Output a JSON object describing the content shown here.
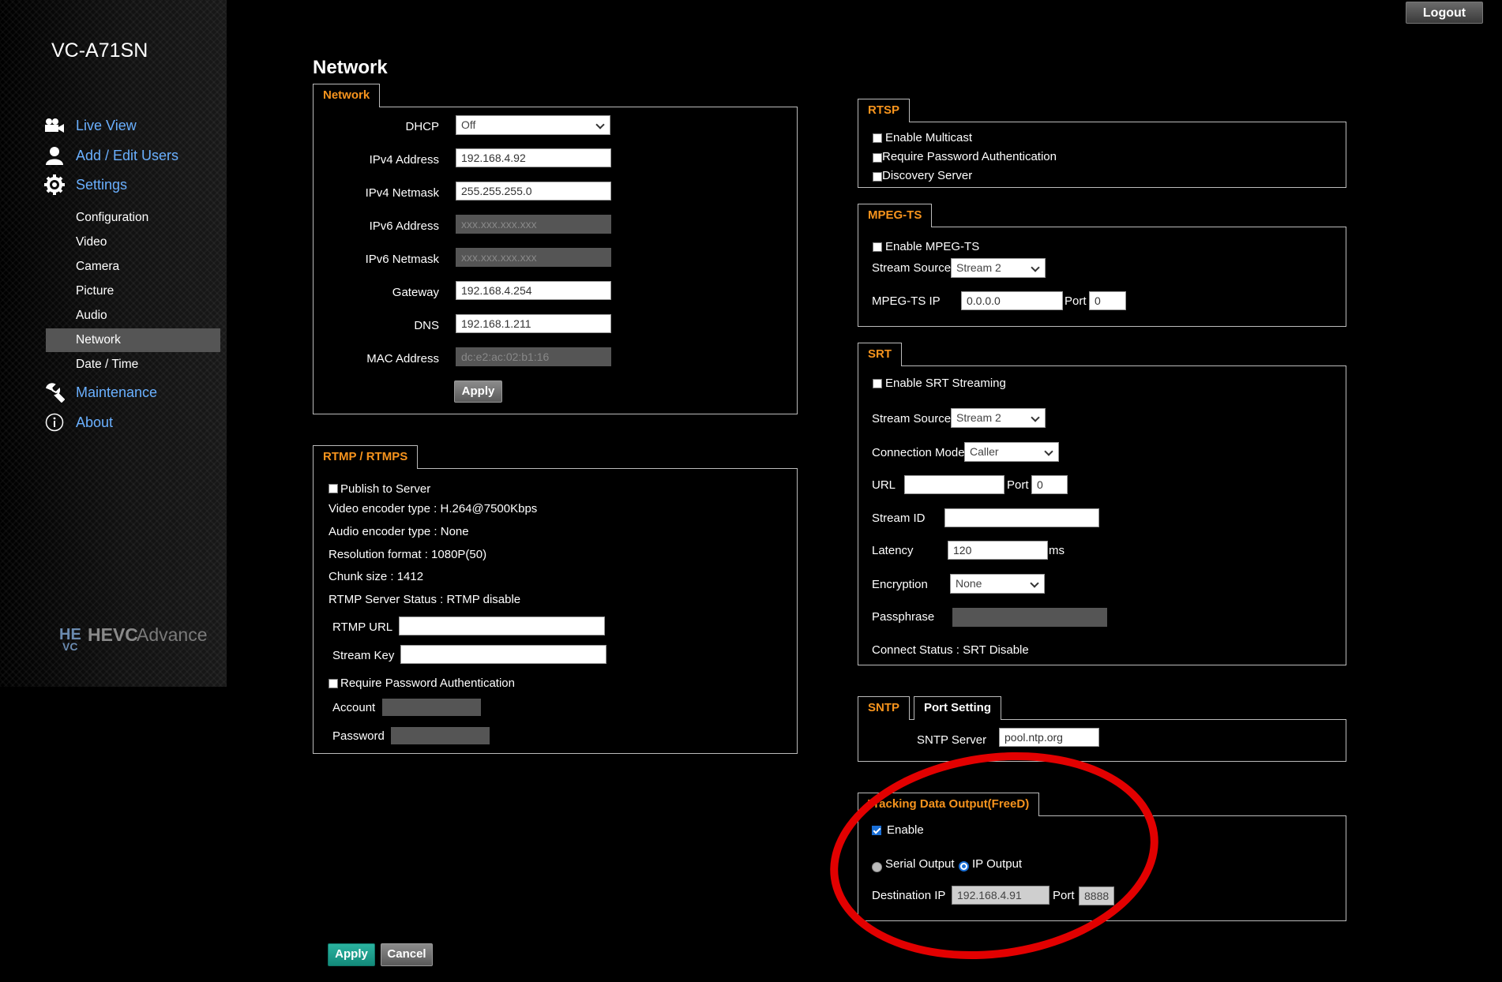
{
  "header": {
    "logout_label": "Logout",
    "device_name": "VC-A71SN"
  },
  "sidebar": {
    "main_items": [
      {
        "label": "Live View",
        "icon": "camera-icon"
      },
      {
        "label": "Add / Edit Users",
        "icon": "user-icon"
      },
      {
        "label": "Settings",
        "icon": "gear-icon"
      },
      {
        "label": "Maintenance",
        "icon": "wrench-icon"
      },
      {
        "label": "About",
        "icon": "info-icon"
      }
    ],
    "sub_items": [
      "Configuration",
      "Video",
      "Camera",
      "Picture",
      "Audio",
      "Network",
      "Date / Time"
    ],
    "active_sub_item": "Network",
    "logo_text": "HEVCAdvance"
  },
  "page": {
    "title": "Network"
  },
  "network": {
    "tab_label": "Network",
    "dhcp_label": "DHCP",
    "dhcp_value": "Off",
    "ipv4_address_label": "IPv4 Address",
    "ipv4_address": "192.168.4.92",
    "ipv4_netmask_label": "IPv4 Netmask",
    "ipv4_netmask": "255.255.255.0",
    "ipv6_address_label": "IPv6 Address",
    "ipv6_address": "xxx.xxx.xxx.xxx",
    "ipv6_netmask_label": "IPv6 Netmask",
    "ipv6_netmask": "xxx.xxx.xxx.xxx",
    "gateway_label": "Gateway",
    "gateway": "192.168.4.254",
    "dns_label": "DNS",
    "dns": "192.168.1.211",
    "mac_label": "MAC Address",
    "mac": "dc:e2:ac:02:b1:16",
    "apply_label": "Apply"
  },
  "rtmp": {
    "tab_label": "RTMP / RTMPS",
    "publish_label": "Publish to Server",
    "video_encoder": "Video encoder type : H.264@7500Kbps",
    "audio_encoder": "Audio encoder type : None",
    "resolution": "Resolution format : 1080P(50)",
    "chunk_size": "Chunk size : 1412",
    "server_status": "RTMP Server Status : RTMP disable",
    "url_label": "RTMP URL",
    "url_value": "",
    "stream_key_label": "Stream Key",
    "stream_key_value": "",
    "require_password_label": "Require Password Authentication",
    "account_label": "Account",
    "password_label": "Password"
  },
  "rtsp": {
    "tab_label": "RTSP",
    "enable_multicast_label": "Enable Multicast",
    "require_password_label": "Require Password Authentication",
    "discovery_server_label": "Discovery Server"
  },
  "mpegts": {
    "tab_label": "MPEG-TS",
    "enable_label": "Enable MPEG-TS",
    "stream_source_label": "Stream Source",
    "stream_source_value": "Stream 2",
    "ip_label": "MPEG-TS IP",
    "ip_value": "0.0.0.0",
    "port_label": "Port",
    "port_value": "0"
  },
  "srt": {
    "tab_label": "SRT",
    "enable_label": "Enable SRT Streaming",
    "stream_source_label": "Stream Source",
    "stream_source_value": "Stream 2",
    "connection_mode_label": "Connection Mode",
    "connection_mode_value": "Caller",
    "url_label": "URL",
    "url_value": "",
    "port_label": "Port",
    "port_value": "0",
    "stream_id_label": "Stream ID",
    "stream_id_value": "",
    "latency_label": "Latency",
    "latency_value": "120",
    "latency_unit": "ms",
    "encryption_label": "Encryption",
    "encryption_value": "None",
    "passphrase_label": "Passphrase",
    "connect_status": "Connect Status : SRT Disable"
  },
  "sntp": {
    "tab_label": "SNTP",
    "port_setting_tab_label": "Port Setting",
    "server_label": "SNTP Server",
    "server_value": "pool.ntp.org"
  },
  "freed": {
    "tab_label": "Tracking Data Output(FreeD)",
    "enable_label": "Enable",
    "enabled": true,
    "serial_output_label": "Serial Output",
    "ip_output_label": "IP Output",
    "selected_output": "IP Output",
    "destination_ip_label": "Destination IP",
    "destination_ip_value": "192.168.4.91",
    "port_label": "Port",
    "port_value": "8888"
  },
  "footer": {
    "apply_label": "Apply",
    "cancel_label": "Cancel"
  },
  "colors": {
    "accent_orange": "#f7941d",
    "nav_blue": "#6ab0ff",
    "apply_teal": "#1a9e8c",
    "annotation_red": "#e20000"
  }
}
